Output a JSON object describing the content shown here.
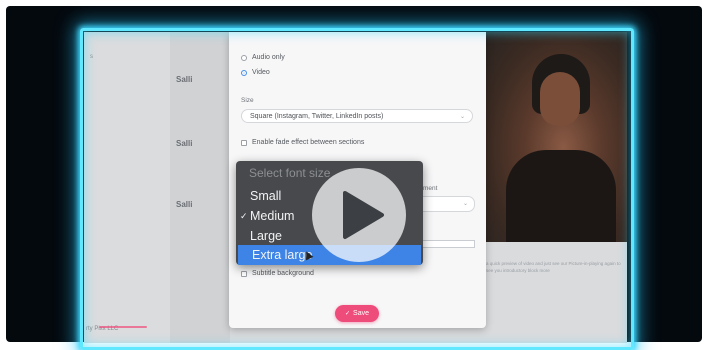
{
  "background": {
    "names": [
      "Salli",
      "Salli",
      "Salli"
    ],
    "footer_brand": "rty Pixx LLC",
    "edge_char": "s"
  },
  "modal": {
    "audio_only_label": "Audio only",
    "video_label": "Video",
    "size_label": "Size",
    "size_value": "Square (Instagram, Twitter, LinkedIn posts)",
    "fade_label": "Enable fade effect between sections",
    "align_label_fragment": "ment",
    "subtitle_bg_label": "Subtitle background",
    "save_label": "Save"
  },
  "font_dropdown": {
    "placeholder": "Select font size",
    "options": [
      "Small",
      "Medium",
      "Large",
      "Extra large"
    ],
    "checked": "Medium",
    "highlighted": "Extra large",
    "check_glyph": "✓"
  },
  "photo_caption": "a quick preview of video and just see our Picture-in-playing again to see you introductory block more",
  "colors": {
    "glow": "#5fe8ff",
    "save": "#ee4c7a",
    "highlight": "#3d84e6",
    "dropdown_bg": "#47494c"
  },
  "icons": {
    "play": "play-icon",
    "chevron": "chevron-down-icon"
  }
}
